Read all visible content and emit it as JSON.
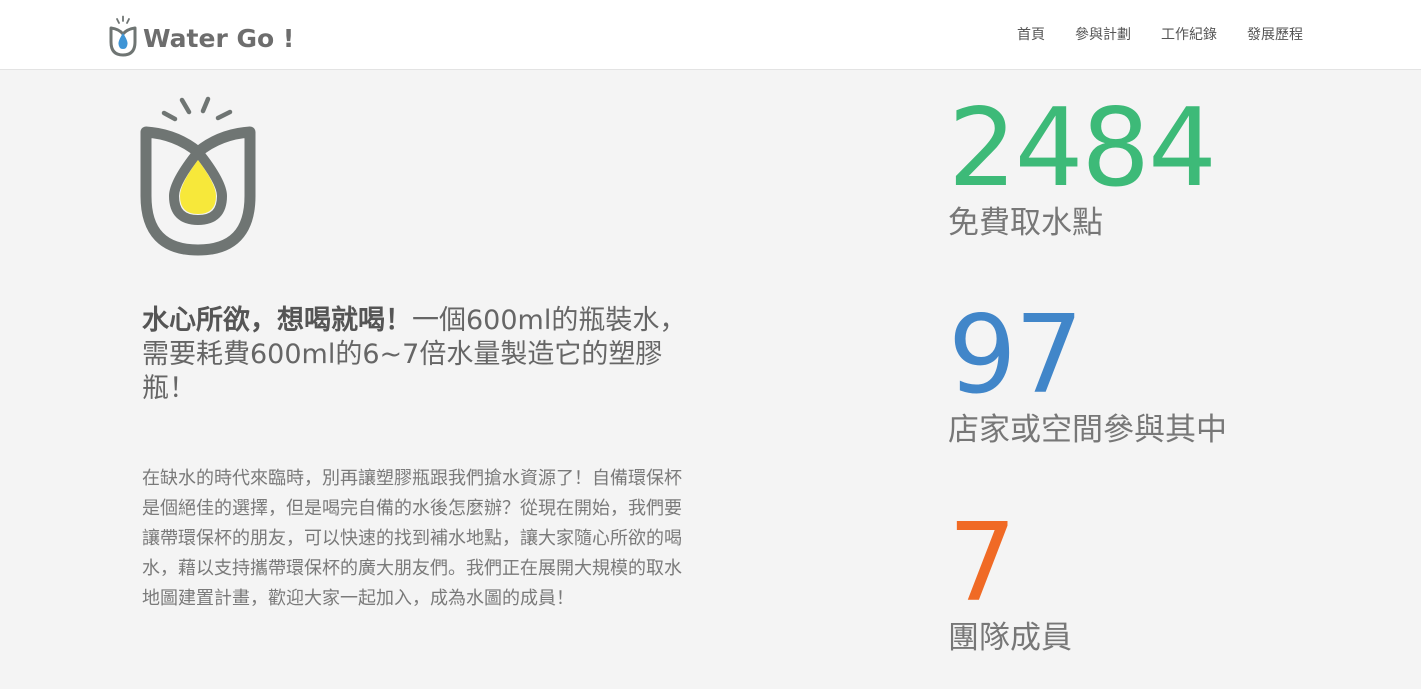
{
  "navbar": {
    "brand_text": "Water Go !",
    "items": [
      {
        "label": "首頁"
      },
      {
        "label": "參與計劃"
      },
      {
        "label": "工作紀錄"
      },
      {
        "label": "發展歷程"
      }
    ]
  },
  "intro": {
    "headline_strong": "水心所欲，想喝就喝！",
    "headline_rest": "一個600ml的瓶裝水，需要耗費600ml的6~7倍水量製造它的塑膠瓶！",
    "body": "在缺水的時代來臨時，別再讓塑膠瓶跟我們搶水資源了！自備環保杯是個絕佳的選擇，但是喝完自備的水後怎麼辦？從現在開始，我們要讓帶環保杯的朋友，可以快速的找到補水地點，讓大家隨心所欲的喝水，藉以支持攜帶環保杯的廣大朋友們。我們正在展開大規模的取水地圖建置計畫，歡迎大家一起加入，成為水圖的成員！"
  },
  "stats": [
    {
      "value": "2484",
      "label": "免費取水點",
      "color": "#3dba78"
    },
    {
      "value": "97",
      "label": "店家或空間參與其中",
      "color": "#4186c9"
    },
    {
      "value": "7",
      "label": "團隊成員",
      "color": "#f06a25"
    }
  ],
  "colors": {
    "logo_gray": "#6f7573",
    "drop_yellow": "#f7e83a",
    "drop_blue": "#3f95d6"
  }
}
